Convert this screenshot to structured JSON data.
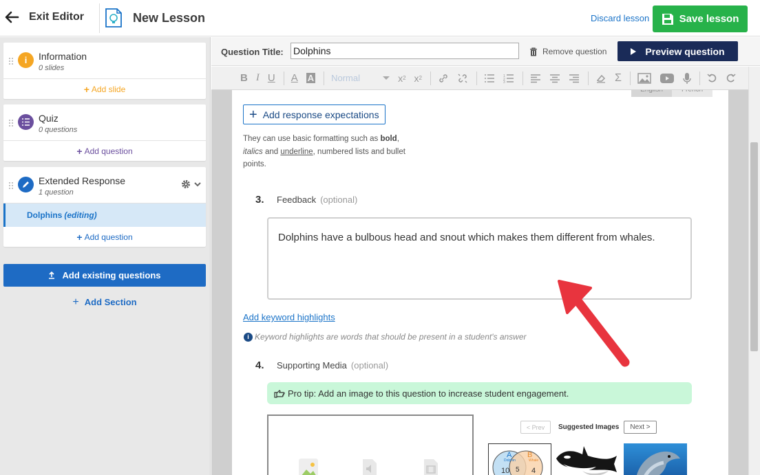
{
  "header": {
    "exit_label": "Exit Editor",
    "lesson_title": "New Lesson",
    "discard_label": "Discard lesson",
    "save_label": "Save lesson"
  },
  "sidebar": {
    "sections": [
      {
        "title": "Information",
        "subtitle": "0 slides",
        "footer": "Add slide",
        "icon": "info-icon",
        "color": "#f5a623"
      },
      {
        "title": "Quiz",
        "subtitle": "0 questions",
        "footer": "Add question",
        "icon": "checklist-icon",
        "color": "#6b4f9e"
      },
      {
        "title": "Extended Response",
        "subtitle": "1 question",
        "footer": "Add question",
        "icon": "pencil-icon",
        "color": "#1e6bc4"
      }
    ],
    "editing_item": {
      "name": "Dolphins",
      "status": "(editing)"
    },
    "add_existing_label": "Add existing questions",
    "add_section_label": "Add Section"
  },
  "question_bar": {
    "title_label": "Question Title:",
    "title_value": "Dolphins",
    "remove_label": "Remove question",
    "preview_label": "Preview question"
  },
  "toolbar": {
    "format_select": "Normal"
  },
  "language_tabs": [
    "English",
    "French"
  ],
  "editor": {
    "response_button": "Add response expectations",
    "format_note": {
      "prefix": "They can use basic formatting such as ",
      "bold": "bold",
      "comma": ",",
      "italics": "italics",
      "and": " and ",
      "underline": "underline",
      "suffix": ", numbered lists and bullet points."
    },
    "feedback": {
      "number": "3.",
      "label": "Feedback",
      "optional": "(optional)",
      "value": "Dolphins have a bulbous head and snout which makes them different from whales."
    },
    "keyword_link": "Add keyword highlights",
    "keyword_info": "Keyword highlights are words that should be present in a student's answer",
    "media": {
      "number": "4.",
      "label": "Supporting Media",
      "optional": "(optional)",
      "protip": "Pro tip: Add an image to this question to increase student engagement.",
      "prev": "< Prev",
      "suggested": "Suggested Images",
      "next": "Next >"
    },
    "venn": {
      "a": "A",
      "b": "B",
      "a_label": "Dolphin",
      "b_label": "Whale",
      "left": "10",
      "mid": "5",
      "right": "4"
    }
  },
  "colors": {
    "save_green": "#27b24a",
    "preview_navy": "#1a2b58",
    "link_blue": "#1a73c8",
    "protip_green": "#c9f7d9",
    "annotation_red": "#e8343e"
  }
}
